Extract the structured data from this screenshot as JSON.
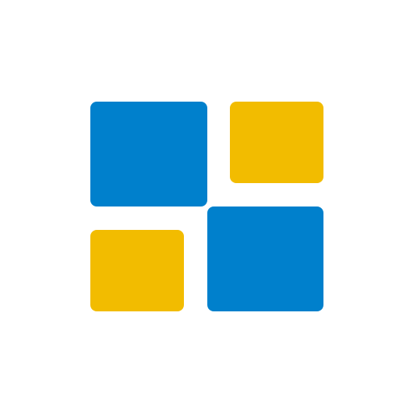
{
  "icon": {
    "name": "tiles-logo-icon",
    "colors": {
      "background": "#ffffff",
      "blue": "#0080CC",
      "yellow": "#F2BC00"
    }
  }
}
